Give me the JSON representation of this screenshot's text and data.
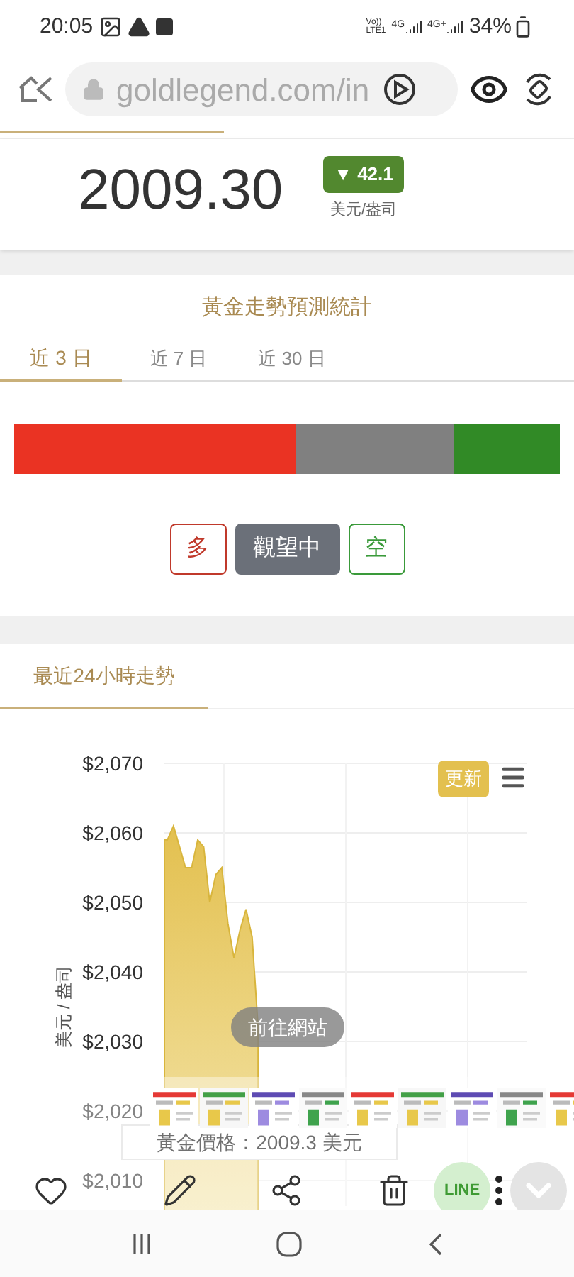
{
  "status_bar": {
    "time": "20:05",
    "volte": [
      "Vo))",
      "LTE1"
    ],
    "networks": [
      "4G",
      "4G+"
    ],
    "battery": "34%"
  },
  "browser": {
    "url": "goldlegend.com/in"
  },
  "price": {
    "value": "2009.30",
    "change": "▼ 42.1",
    "unit": "美元/盎司"
  },
  "forecast": {
    "title": "黃金走勢預測統計",
    "tabs": [
      {
        "label": "近 3 日",
        "selected": true
      },
      {
        "label": "近 7 日",
        "selected": false
      },
      {
        "label": "近 30 日",
        "selected": false
      }
    ],
    "fills": [
      {
        "kind": "left",
        "level": 0.518,
        "color": "#ea3323"
      },
      {
        "kind": "right",
        "level": 0.194,
        "color": "#318a26"
      }
    ],
    "choices": [
      {
        "label": "多",
        "selected": false,
        "color": "#c0392b"
      },
      {
        "label": "觀望中",
        "selected": true,
        "color": "#6b7079"
      },
      {
        "label": "空",
        "selected": false,
        "color": "#3a9a3a"
      }
    ]
  },
  "trend": {
    "tab": "最近24小時走勢",
    "update_button": "更新",
    "tooltip": "黃金價格：2009.3 美元",
    "visit_button": "前往網站",
    "chart_data": {
      "type": "area",
      "ylabel": "美元 / 盎司",
      "grid": true,
      "ylim": [
        2010,
        2070
      ],
      "yticks": [
        {
          "value": 2070,
          "label": "$2,070"
        },
        {
          "value": 2060,
          "label": "$2,060"
        },
        {
          "value": 2050,
          "label": "$2,050"
        },
        {
          "value": 2040,
          "label": "$2,040"
        },
        {
          "value": 2030,
          "label": "$2,030"
        },
        {
          "value": 2020,
          "label": "$2,020"
        },
        {
          "value": 2010,
          "label": "$2,010"
        }
      ],
      "values": [
        2059,
        2061,
        2058,
        2055,
        2055,
        2059,
        2058,
        2050,
        2054,
        2055,
        2047,
        2042,
        2046,
        2049,
        2045,
        2032,
        null,
        null,
        null,
        null,
        null,
        null,
        null,
        null,
        null,
        null,
        null,
        null,
        null,
        null,
        null,
        null,
        null,
        null,
        null,
        null,
        null,
        null,
        null,
        null,
        null,
        null,
        null,
        null,
        null,
        null,
        null,
        null,
        null,
        null,
        null,
        null,
        null,
        null,
        null,
        null,
        null,
        null,
        null,
        null
      ]
    }
  },
  "share_sheet": {
    "actions": [
      {
        "kind": "like"
      },
      {
        "kind": "edit"
      },
      {
        "kind": "share"
      },
      {
        "kind": "delete"
      },
      {
        "kind": "line",
        "label": "LINE"
      },
      {
        "kind": "more"
      },
      {
        "kind": "collapse"
      }
    ]
  }
}
